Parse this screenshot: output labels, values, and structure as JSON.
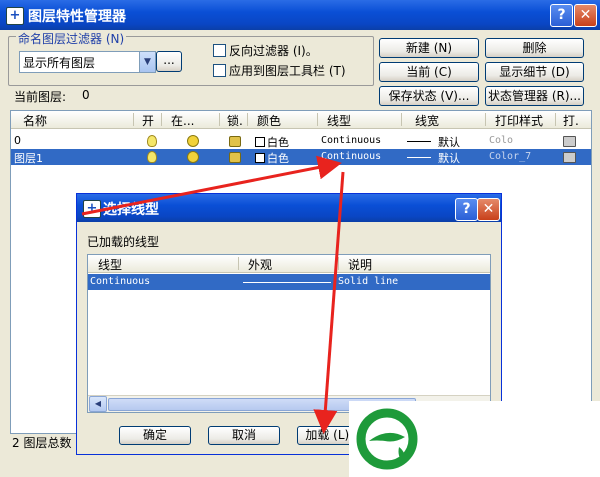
{
  "window": {
    "title": "图层特性管理器",
    "help_glyph": "?",
    "close_glyph": "✕"
  },
  "filter": {
    "legend": "命名图层过滤器 (N)",
    "combo_value": "显示所有图层",
    "browse_label": "...",
    "invert_label": "反向过滤器 (I)。",
    "apply_toolbar_label": "应用到图层工具栏 (T)"
  },
  "buttons": {
    "new": "新建 (N)",
    "delete": "删除",
    "current": "当前 (C)",
    "show_details": "显示细节 (D)",
    "save_state": "保存状态 (V)...",
    "state_manager": "状态管理器 (R)..."
  },
  "current_layer": {
    "label": "当前图层:",
    "value": "0"
  },
  "layer_table": {
    "columns": [
      "名称",
      "开",
      "在...",
      "锁.",
      "颜色",
      "线型",
      "线宽",
      "打印样式",
      "打."
    ],
    "rows": [
      {
        "name": "0",
        "color": "白色",
        "linetype": "Continuous",
        "lineweight": "默认",
        "plot_style": "Colo"
      },
      {
        "name": "图层1",
        "color": "白色",
        "linetype": "Continuous",
        "lineweight": "默认",
        "plot_style": "Color_7"
      }
    ]
  },
  "status": {
    "text": "2 图层总数"
  },
  "dialog": {
    "title": "选择线型",
    "help_glyph": "?",
    "close_glyph": "✕",
    "section_label": "已加载的线型",
    "columns": [
      "线型",
      "外观",
      "说明"
    ],
    "rows": [
      {
        "linetype": "Continuous",
        "description": "Solid line"
      }
    ],
    "buttons": {
      "ok": "确定",
      "cancel": "取消",
      "load": "加载 (L)..."
    }
  },
  "colors": {
    "title_bar": "#0A4FD6",
    "selection": "#316AC5",
    "annotation_arrow": "#E8231E",
    "logo_green": "#1E9A3A"
  }
}
